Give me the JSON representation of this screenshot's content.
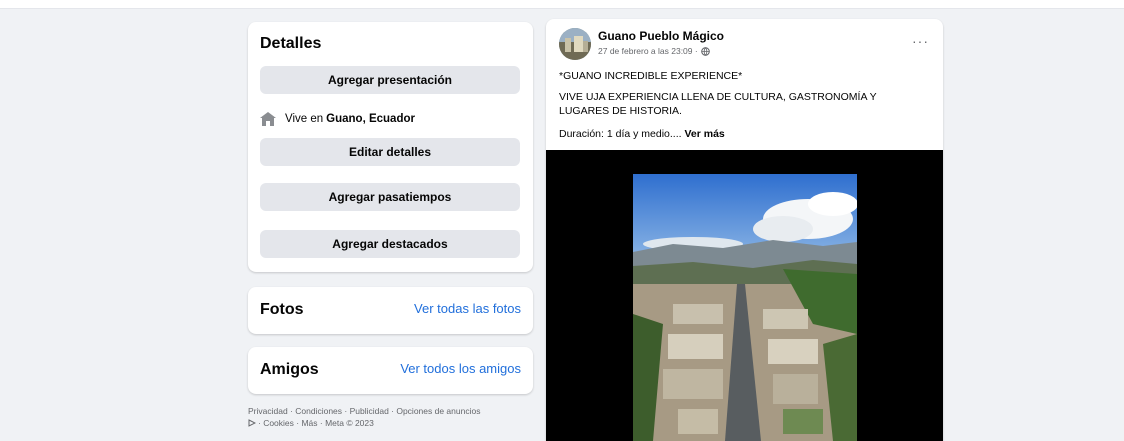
{
  "details": {
    "title": "Detalles",
    "add_intro": "Agregar presentación",
    "lives_prefix": "Vive en",
    "lives_place": "Guano, Ecuador",
    "edit_details": "Editar detalles",
    "add_hobbies": "Agregar pasatiempos",
    "add_featured": "Agregar destacados"
  },
  "photos": {
    "title": "Fotos",
    "link": "Ver todas las fotos"
  },
  "friends": {
    "title": "Amigos",
    "link": "Ver todos los amigos"
  },
  "footer": {
    "line1": "Privacidad · Condiciones · Publicidad · Opciones de anuncios",
    "line2": "· Cookies · Más · Meta © 2023"
  },
  "post": {
    "author": "Guano Pueblo Mágico",
    "date": "27 de febrero a las 23:09 ·",
    "more": "···",
    "line1": "*GUANO INCREDIBLE EXPERIENCE*",
    "line2": "VIVE UJA EXPERIENCIA LLENA DE CULTURA, GASTRONOMÍA Y LUGARES DE HISTORIA.",
    "line3": "Duración: 1 día y medio....",
    "see_more": "Ver más"
  },
  "icons": {
    "home": "home-icon",
    "globe": "globe-icon",
    "adchoices": "adchoices-icon"
  },
  "colors": {
    "link": "#216fdb",
    "button": "#e4e6eb",
    "background": "#f0f2f5"
  }
}
